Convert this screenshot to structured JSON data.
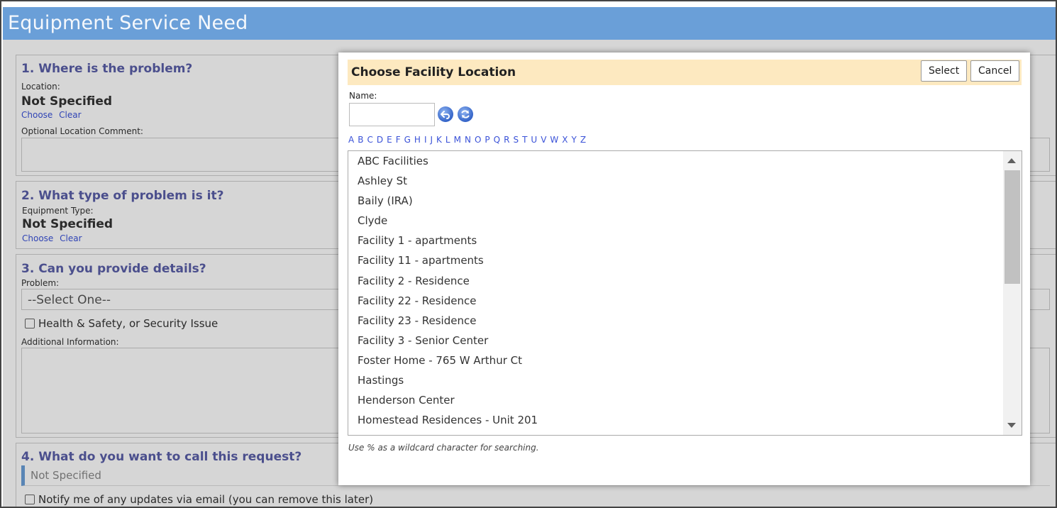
{
  "page": {
    "title": "Equipment Service Need"
  },
  "sections": {
    "location": {
      "title": "1. Where is the problem?",
      "location_label": "Location:",
      "location_value": "Not Specified",
      "choose_link": "Choose",
      "clear_link": "Clear",
      "comment_label": "Optional Location Comment:"
    },
    "type": {
      "title": "2. What type of problem is it?",
      "equipment_label": "Equipment Type:",
      "equipment_value": "Not Specified",
      "choose_link": "Choose",
      "clear_link": "Clear"
    },
    "details": {
      "title": "3. Can you provide details?",
      "problem_label": "Problem:",
      "problem_select_value": "--Select One--",
      "safety_checkbox_label": "Health & Safety, or Security Issue",
      "additional_label": "Additional Information:"
    },
    "request": {
      "title": "4. What do you want to call this request?",
      "name_value": "Not Specified",
      "notify_checkbox_label": "Notify me of any updates via email (you can remove this later)"
    }
  },
  "modal": {
    "title": "Choose Facility Location",
    "select_button": "Select",
    "cancel_button": "Cancel",
    "name_label": "Name:",
    "name_value": "",
    "alphabet": [
      "A",
      "B",
      "C",
      "D",
      "E",
      "F",
      "G",
      "H",
      "I",
      "J",
      "K",
      "L",
      "M",
      "N",
      "O",
      "P",
      "Q",
      "R",
      "S",
      "T",
      "U",
      "V",
      "W",
      "X",
      "Y",
      "Z"
    ],
    "facilities": [
      "ABC Facilities",
      "Ashley St",
      "Baily (IRA)",
      "Clyde",
      "Facility 1 - apartments",
      "Facility 11 - apartments",
      "Facility 2 - Residence",
      "Facility 22 - Residence",
      "Facility 23 - Residence",
      "Facility 3 - Senior Center",
      "Foster Home - 765 W Arthur Ct",
      "Hastings",
      "Henderson Center",
      "Homestead Residences - Unit 201"
    ],
    "hint": "Use % as a wildcard character for searching."
  },
  "colors": {
    "titlebar": "#6a9fd8",
    "section_title": "#5a5fa8",
    "link": "#3a52d8",
    "modal_header": "#fde9c0"
  },
  "icons": {
    "back": "undo-arrow-icon",
    "refresh": "refresh-icon"
  }
}
